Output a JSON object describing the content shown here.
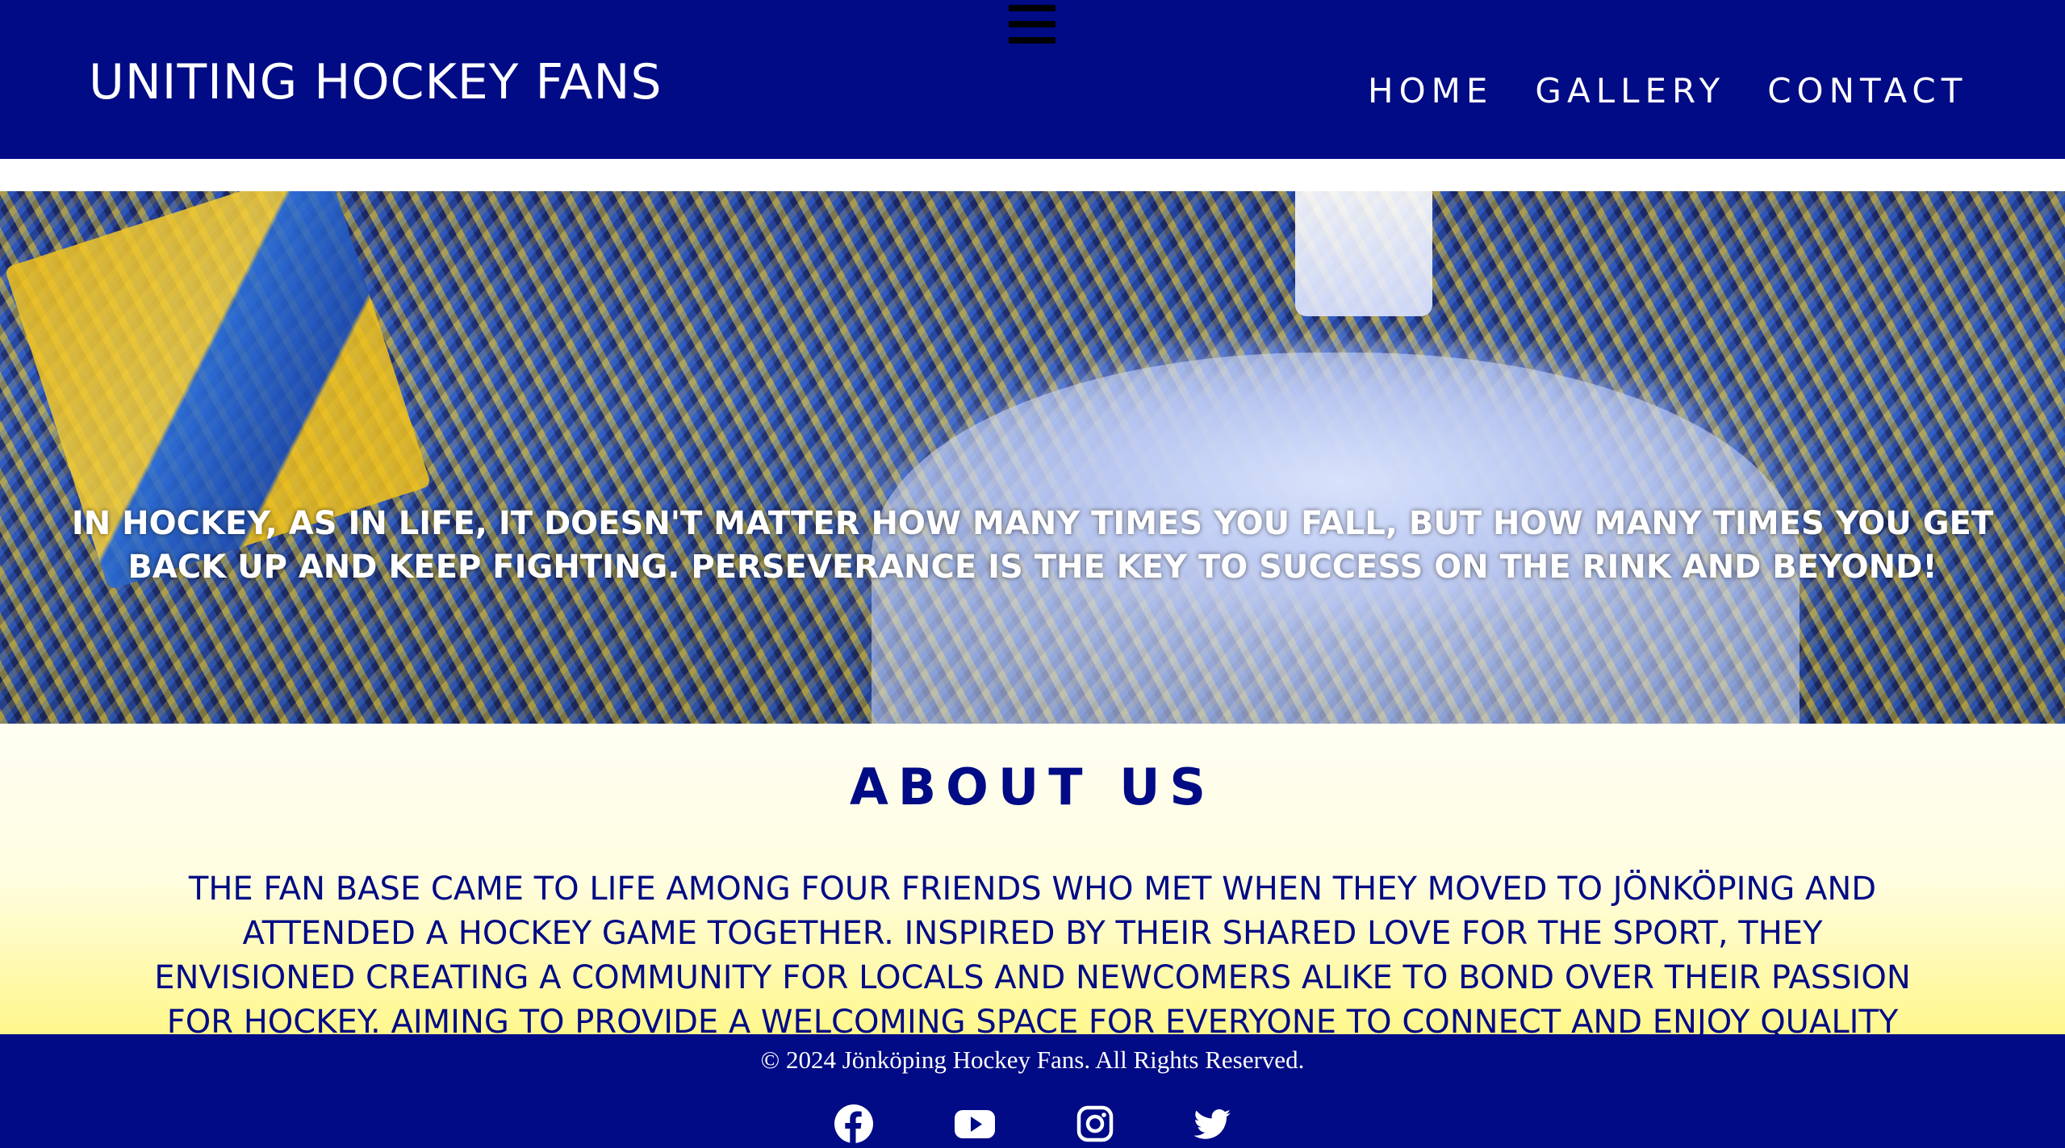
{
  "header": {
    "menu_icon": "hamburger-menu-icon",
    "brand": "UNITING HOCKEY FANS",
    "nav": [
      {
        "label": "HOME"
      },
      {
        "label": "GALLERY"
      },
      {
        "label": "CONTACT"
      }
    ]
  },
  "hero": {
    "quote": "IN HOCKEY, AS IN LIFE, IT DOESN'T MATTER HOW MANY TIMES YOU FALL, BUT HOW MANY TIMES YOU GET BACK UP AND KEEP FIGHTING. PERSEVERANCE IS THE KEY TO SUCCESS ON THE RINK AND BEYOND!"
  },
  "about": {
    "title": "ABOUT US",
    "text": "THE FAN BASE CAME TO LIFE AMONG FOUR FRIENDS WHO MET WHEN THEY MOVED TO JÖNKÖPING AND ATTENDED A HOCKEY GAME TOGETHER. INSPIRED BY THEIR SHARED LOVE FOR THE SPORT, THEY ENVISIONED CREATING A COMMUNITY FOR LOCALS AND NEWCOMERS ALIKE TO BOND OVER THEIR PASSION FOR HOCKEY. AIMING TO PROVIDE A WELCOMING SPACE FOR EVERYONE TO CONNECT AND ENJOY QUALITY TIME WITH LIKE-MINDED INDIVIDUALS. THEY"
  },
  "footer": {
    "copyright": "© 2024 Jönköping Hockey Fans. All Rights Reserved.",
    "social": [
      {
        "icon": "facebook-icon"
      },
      {
        "icon": "youtube-icon"
      },
      {
        "icon": "instagram-icon"
      },
      {
        "icon": "twitter-icon"
      }
    ]
  },
  "colors": {
    "primary": "#000b85",
    "text_light": "#ffffff",
    "about_gradient_end": "#fff78c"
  }
}
